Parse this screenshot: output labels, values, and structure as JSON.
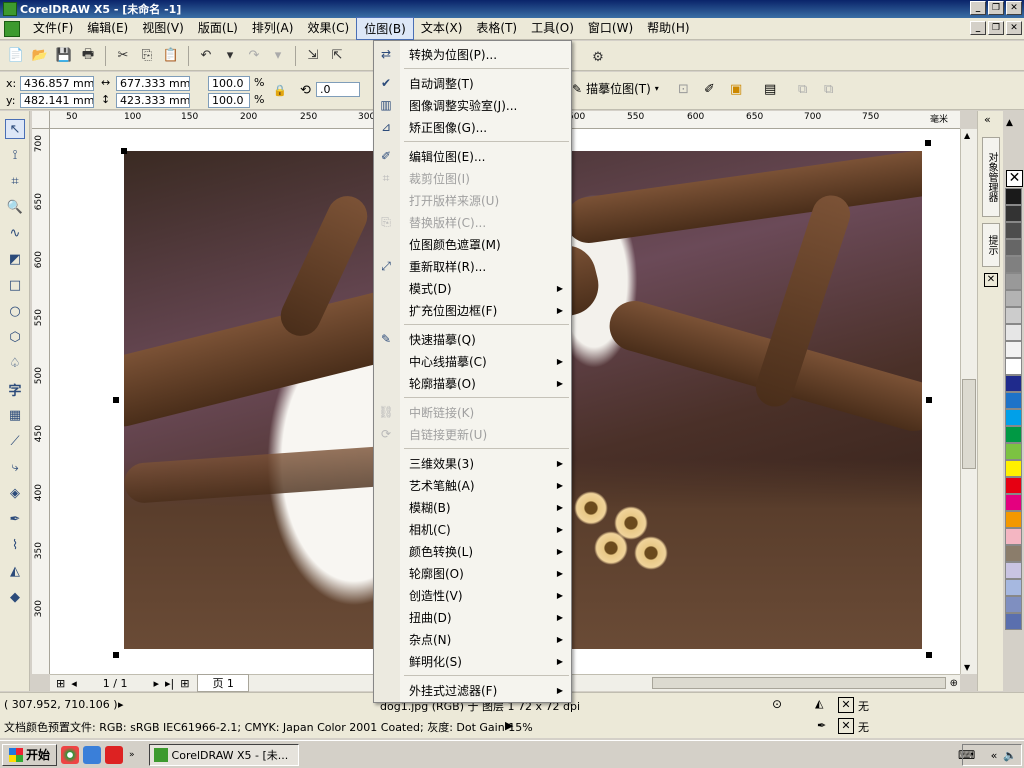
{
  "window": {
    "title": "CorelDRAW X5 - [未命名 -1]"
  },
  "menubar": {
    "items": [
      "文件(F)",
      "编辑(E)",
      "视图(V)",
      "版面(L)",
      "排列(A)",
      "效果(C)",
      "位图(B)",
      "文本(X)",
      "表格(T)",
      "工具(O)",
      "窗口(W)",
      "帮助(H)"
    ],
    "active": "位图(B)"
  },
  "propbar": {
    "x_label": "x:",
    "x_value": "436.857 mm",
    "y_label": "y:",
    "y_value": "482.141 mm",
    "width_value": "677.333 mm",
    "height_value": "423.333 mm",
    "scale_x": "100.0",
    "scale_y": "100.0",
    "percent": "%",
    "rotation": ".0",
    "trace_label": "描摹位图(T)"
  },
  "ruler_top": [
    "50",
    "100",
    "150",
    "200",
    "250",
    "300",
    "500",
    "550",
    "600",
    "650",
    "700",
    "750",
    "毫米"
  ],
  "ruler_left": [
    "700",
    "650",
    "600",
    "550",
    "500",
    "450",
    "400",
    "350",
    "300"
  ],
  "page_nav": {
    "current": "1 / 1",
    "tab": "页 1"
  },
  "bitmap_menu": {
    "groups": [
      [
        {
          "label": "转换为位图(P)...",
          "icon": "convert-to-bitmap-icon",
          "disabled": false,
          "submenu": false
        }
      ],
      [
        {
          "label": "自动调整(T)",
          "icon": "auto-adjust-icon",
          "disabled": false,
          "submenu": false
        },
        {
          "label": "图像调整实验室(J)...",
          "icon": "image-adjustment-lab-icon",
          "disabled": false,
          "submenu": false
        },
        {
          "label": "矫正图像(G)...",
          "icon": "straighten-image-icon",
          "disabled": false,
          "submenu": false
        }
      ],
      [
        {
          "label": "编辑位图(E)...",
          "icon": "edit-bitmap-icon",
          "disabled": false,
          "submenu": false
        },
        {
          "label": "裁剪位图(I)",
          "icon": "crop-bitmap-icon",
          "disabled": true,
          "submenu": false
        },
        {
          "label": "打开版样来源(U)",
          "icon": "",
          "disabled": true,
          "submenu": false
        },
        {
          "label": "替换版样(C)...",
          "icon": "resample-link-icon",
          "disabled": true,
          "submenu": false
        },
        {
          "label": "位图颜色遮罩(M)",
          "icon": "",
          "disabled": false,
          "submenu": false
        },
        {
          "label": "重新取样(R)...",
          "icon": "resample-icon",
          "disabled": false,
          "submenu": false
        },
        {
          "label": "模式(D)",
          "icon": "",
          "disabled": false,
          "submenu": true
        },
        {
          "label": "扩充位图边框(F)",
          "icon": "",
          "disabled": false,
          "submenu": true
        }
      ],
      [
        {
          "label": "快速描摹(Q)",
          "icon": "quick-trace-icon",
          "disabled": false,
          "submenu": false
        },
        {
          "label": "中心线描摹(C)",
          "icon": "",
          "disabled": false,
          "submenu": true
        },
        {
          "label": "轮廓描摹(O)",
          "icon": "",
          "disabled": false,
          "submenu": true
        }
      ],
      [
        {
          "label": "中断链接(K)",
          "icon": "break-link-icon",
          "disabled": true,
          "submenu": false
        },
        {
          "label": "自链接更新(U)",
          "icon": "update-link-icon",
          "disabled": true,
          "submenu": false
        }
      ],
      [
        {
          "label": "三维效果(3)",
          "icon": "",
          "disabled": false,
          "submenu": true
        },
        {
          "label": "艺术笔触(A)",
          "icon": "",
          "disabled": false,
          "submenu": true
        },
        {
          "label": "模糊(B)",
          "icon": "",
          "disabled": false,
          "submenu": true
        },
        {
          "label": "相机(C)",
          "icon": "",
          "disabled": false,
          "submenu": true
        },
        {
          "label": "颜色转换(L)",
          "icon": "",
          "disabled": false,
          "submenu": true
        },
        {
          "label": "轮廓图(O)",
          "icon": "",
          "disabled": false,
          "submenu": true
        },
        {
          "label": "创造性(V)",
          "icon": "",
          "disabled": false,
          "submenu": true
        },
        {
          "label": "扭曲(D)",
          "icon": "",
          "disabled": false,
          "submenu": true
        },
        {
          "label": "杂点(N)",
          "icon": "",
          "disabled": false,
          "submenu": true
        },
        {
          "label": "鲜明化(S)",
          "icon": "",
          "disabled": false,
          "submenu": true
        }
      ],
      [
        {
          "label": "外挂式过滤器(F)",
          "icon": "",
          "disabled": false,
          "submenu": true
        }
      ]
    ]
  },
  "status": {
    "cursor_pos": "( 307.952, 710.106 )",
    "object_info": "dog1.jpg (RGB) 于 图层 1 72 x 72 dpi",
    "fill_label": "无",
    "outline_label": "无",
    "profile": "文档颜色预置文件: RGB: sRGB IEC61966-2.1; CMYK: Japan Color 2001 Coated; 灰度: Dot Gain 15%"
  },
  "docker_tabs": [
    "对象管理器",
    "提示"
  ],
  "palette": [
    "#ffffff",
    "#000000",
    "#1a1a1a",
    "#333333",
    "#4d4d4d",
    "#666666",
    "#808080",
    "#999999",
    "#b3b3b3",
    "#cccccc",
    "#e6e6e6",
    "#f2f2f2",
    "#ffffff",
    "#1f2a8c",
    "#1e73c8",
    "#00a0e9",
    "#009944",
    "#7cc242",
    "#fff100",
    "#e60012",
    "#e4007f",
    "#f39800",
    "#f4b6c2",
    "#8b7d6b",
    "#c9c4e2",
    "#a6b8e0",
    "#7f8fc0",
    "#5a6fae"
  ],
  "taskbar": {
    "start": "开始",
    "task": "CorelDRAW X5 - [未..."
  }
}
